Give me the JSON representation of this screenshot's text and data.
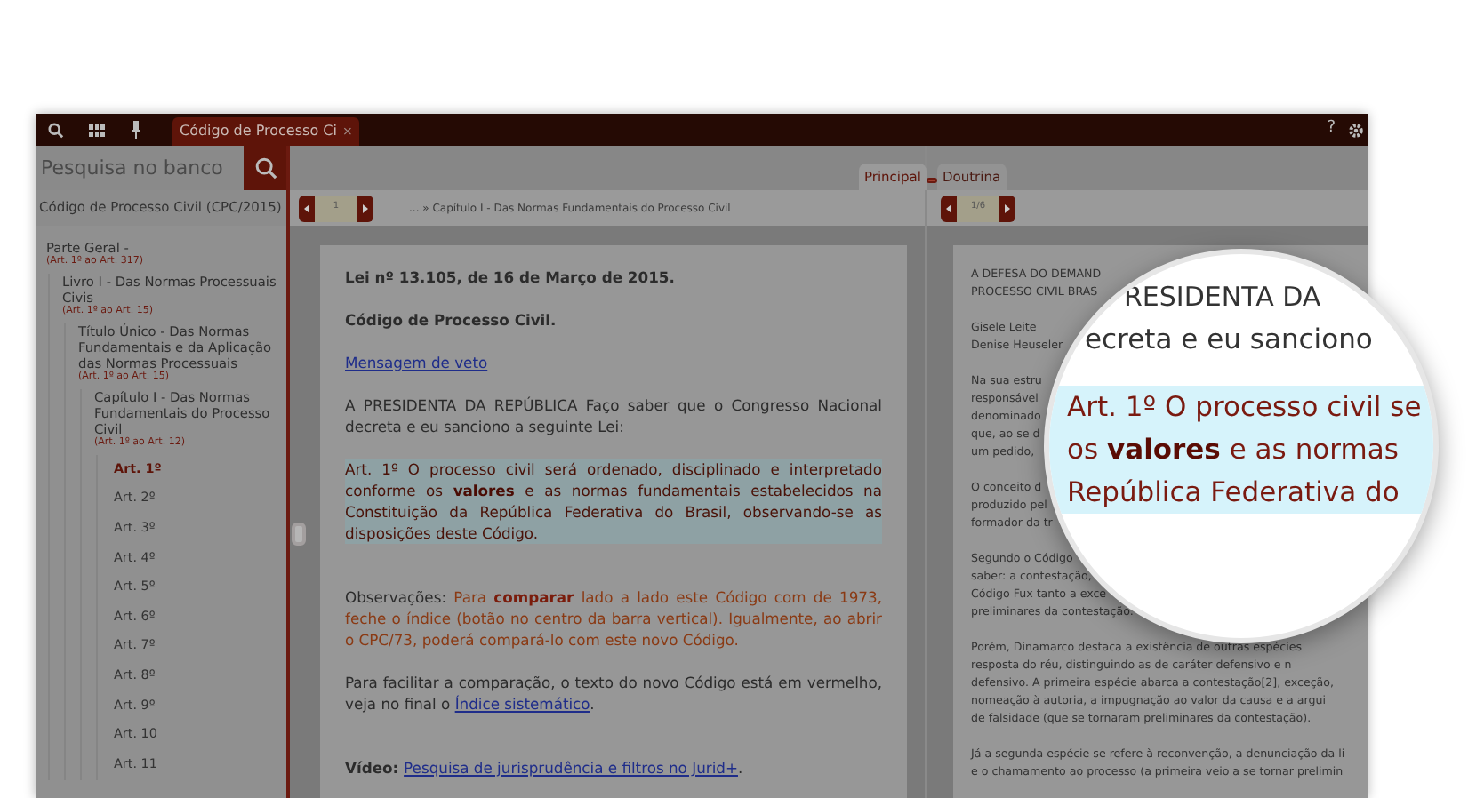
{
  "toolbar": {
    "tab": {
      "label": "Código de Processo Ci",
      "close": "×",
      "selected": true
    },
    "help": "?"
  },
  "search": {
    "placeholder": "Pesquisa no banco"
  },
  "sidebar": {
    "title": "Código de Processo Civil (CPC/2015)",
    "tree": [
      {
        "label": "Parte Geral -",
        "range": "(Art. 1º ao Art. 317)",
        "children": [
          {
            "label": "Livro I - Das Normas Processuais Civis",
            "range": "(Art. 1º ao Art. 15)",
            "children": [
              {
                "label": "Título Único - Das Normas Fundamentais e da Aplicação das Normas Processuais",
                "range": "(Art. 1º ao Art. 15)",
                "children": [
                  {
                    "label": "Capítulo I - Das Normas Fundamentais do Processo Civil",
                    "range": "(Art. 1º ao Art. 12)",
                    "children": [
                      {
                        "label": "Art. 1º",
                        "selected": true
                      },
                      {
                        "label": "Art. 2º",
                        "selected": false
                      },
                      {
                        "label": "Art. 3º",
                        "selected": false
                      },
                      {
                        "label": "Art. 4º",
                        "selected": false
                      },
                      {
                        "label": "Art. 5º",
                        "selected": false
                      },
                      {
                        "label": "Art. 6º",
                        "selected": false
                      },
                      {
                        "label": "Art. 7º",
                        "selected": false
                      },
                      {
                        "label": "Art. 8º",
                        "selected": false
                      },
                      {
                        "label": "Art. 9º",
                        "selected": false
                      },
                      {
                        "label": "Art. 10",
                        "selected": false
                      },
                      {
                        "label": "Art. 11",
                        "selected": false
                      }
                    ]
                  }
                ]
              }
            ]
          }
        ]
      }
    ]
  },
  "main": {
    "pager": {
      "page": "1"
    },
    "breadcrumb": "... » Capítulo I - Das Normas Fundamentais do Processo Civil",
    "paragraphs": [
      {
        "kind": "heading",
        "text": "Lei nº 13.105, de 16 de Março de 2015."
      },
      {
        "kind": "heading",
        "text": "Código de Processo Civil."
      },
      {
        "kind": "link",
        "text": "Mensagem de veto"
      },
      {
        "kind": "text",
        "text": "A PRESIDENTA DA REPÚBLICA Faço saber que o Congresso Nacional decreta e eu sanciono a seguinte Lei:"
      },
      {
        "kind": "highlight",
        "text": "Art. 1º O processo civil será ordenado, disciplinado e interpretado conforme os **valores** e as normas fundamentais estabelecidos na Constituição da República Federativa do Brasil, observando-se as disposições deste Código."
      },
      {
        "kind": "note",
        "label": "Observações:",
        "text": "Para **comparar** lado a lado este Código com de 1973, feche o índice (botão no centro da barra vertical). Igualmente, ao abrir o CPC/73, poderá compará-lo com este novo Código."
      },
      {
        "kind": "text_link",
        "text": "Para facilitar a comparação, o texto do novo Código está em vermelho, veja no final o",
        "link": "Índice sistemático",
        "after": "."
      },
      {
        "kind": "video",
        "label": "Vídeo:",
        "link": "Pesquisa de jurisprudência e filtros no Jurid+",
        "after": "."
      }
    ]
  },
  "side_panel": {
    "tabs": [
      {
        "label": "Principal",
        "selected": true
      },
      {
        "label": "Doutrina",
        "selected": false
      }
    ],
    "pager": {
      "page": "1/6"
    },
    "paragraphs": [
      {
        "lines": [
          "A DEFESA DO DEMAND",
          "PROCESSO CIVIL BRAS"
        ]
      },
      {
        "lines": [
          "Gisele Leite",
          "Denise Heuseler"
        ]
      },
      {
        "lines": [
          "Na sua estru",
          "responsável",
          "denominado",
          "que, ao se d",
          "um pedido,"
        ]
      },
      {
        "lines": [
          "O conceito d",
          "produzido pel",
          "formador da tr"
        ]
      },
      {
        "lines": [
          "Segundo o Código",
          "saber: a contestação,",
          "Código Fux tanto a exce",
          "preliminares da contestação."
        ]
      },
      {
        "lines": [
          "Porém, Dinamarco destaca a existência de outras espécies",
          "resposta do réu, distinguindo as de caráter defensivo e n",
          "defensivo. A primeira espécie abarca a contestação[2], exceção,",
          "nomeação à autoria, a impugnação ao valor da causa e a argui",
          "de falsidade (que se tornaram preliminares da contestação)."
        ]
      },
      {
        "lines": [
          "Já a segunda espécie se refere à reconvenção, a denunciação da li",
          "e o chamamento ao processo (a primeira veio a se tornar prelimin"
        ]
      }
    ]
  },
  "magnifier": {
    "lines": [
      {
        "kind": "text",
        "text": "RESIDENTA DA"
      },
      {
        "kind": "text",
        "text": "ecreta e eu sanciono"
      },
      {
        "kind": "highlight",
        "text": "Art. 1º O processo civil se"
      },
      {
        "kind": "highlight",
        "text": "os **valores** e as normas"
      },
      {
        "kind": "highlight",
        "text": "República Federativa do"
      }
    ]
  }
}
